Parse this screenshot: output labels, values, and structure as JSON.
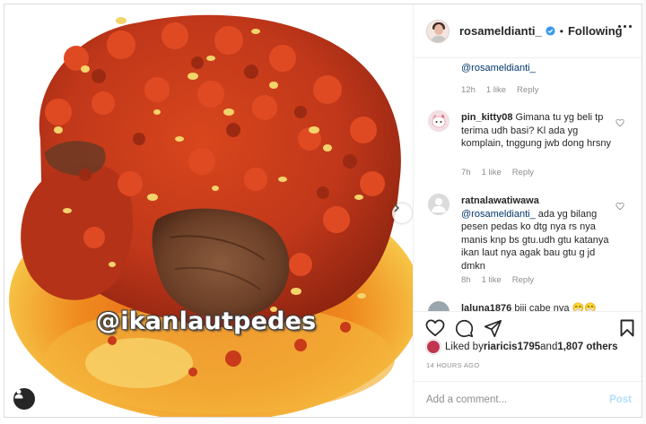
{
  "post": {
    "watermark": "@ikanlautpedes"
  },
  "header": {
    "username": "rosameldianti_",
    "separator": "•",
    "follow_state": "Following"
  },
  "comments": {
    "partial_top": {
      "text_visible": "",
      "mention": "@rosameldianti_",
      "meta": {
        "time": "12h",
        "likes": "1 like",
        "reply": "Reply"
      }
    },
    "items": [
      {
        "user": "pin_kitty08",
        "text": " Gimana tu yg beli tp terima udh basi? Kl ada yg komplain, tnggung jwb dong hrsny",
        "meta": {
          "time": "7h",
          "likes": "1 like",
          "reply": "Reply"
        }
      },
      {
        "user": "ratnalawatiwawa",
        "mention": "@rosameldianti_",
        "text": " ada yg bilang pesen pedas ko dtg nya rs nya manis knp bs gtu.udh gtu katanya ikan laut nya agak bau gtu g jd dmkn",
        "meta": {
          "time": "8h",
          "likes": "1 like",
          "reply": "Reply"
        }
      },
      {
        "user": "laluna1876",
        "text": " biji cabe nya 😁😁"
      }
    ]
  },
  "likes": {
    "prefix": "Liked by ",
    "user": "riaricis1795",
    "middle": " and ",
    "count": "1,807 others"
  },
  "timestamp": "14 HOURS AGO",
  "composer": {
    "placeholder": "Add a comment...",
    "post_label": "Post"
  },
  "colors": {
    "link": "#00376b",
    "muted": "#8e8e8e",
    "post_disabled": "#b2dffc",
    "verified": "#3897f0"
  }
}
